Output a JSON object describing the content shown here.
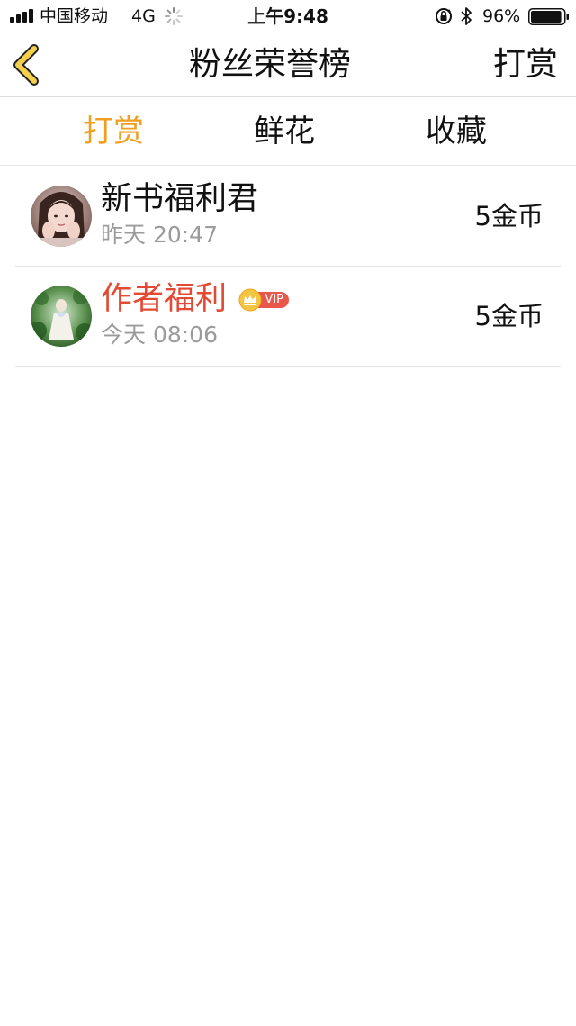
{
  "status_bar": {
    "carrier": "中国移动",
    "network": "4G",
    "time": "上午9:48",
    "battery_percent": "96%",
    "battery_level": 0.96
  },
  "nav": {
    "title": "粉丝荣誉榜",
    "right_action": "打赏",
    "back_icon": "chevron-left-icon",
    "back_icon_color": "#f5d04a"
  },
  "tabs": [
    {
      "label": "打赏",
      "active": true
    },
    {
      "label": "鲜花",
      "active": false
    },
    {
      "label": "收藏",
      "active": false
    }
  ],
  "colors": {
    "accent": "#f0a020",
    "vip_name": "#e24a34",
    "subtext": "#9b9b9b",
    "vip_badge": "#e9574b",
    "crown": "#f4c542"
  },
  "list": [
    {
      "name": "新书福利君",
      "time": "昨天 20:47",
      "amount": "5金币",
      "vip": false
    },
    {
      "name": "作者福利",
      "time": "今天 08:06",
      "amount": "5金币",
      "vip": true,
      "vip_label": "VIP"
    }
  ]
}
